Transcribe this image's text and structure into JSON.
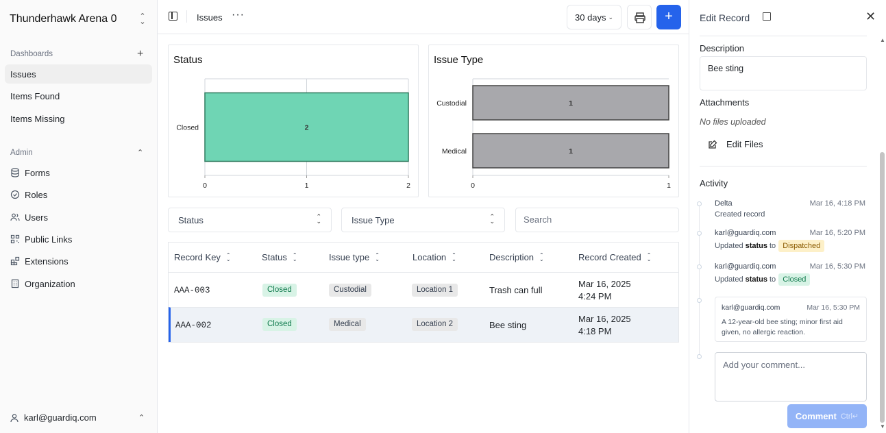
{
  "sidebar": {
    "org_name": "Thunderhawk Arena 0",
    "dashboards_label": "Dashboards",
    "dashboard_items": [
      {
        "label": "Issues",
        "active": true
      },
      {
        "label": "Items Found"
      },
      {
        "label": "Items Missing"
      }
    ],
    "admin_label": "Admin",
    "admin_items": [
      {
        "label": "Forms",
        "icon": "database-icon"
      },
      {
        "label": "Roles",
        "icon": "check-circle-icon"
      },
      {
        "label": "Users",
        "icon": "users-icon"
      },
      {
        "label": "Public Links",
        "icon": "qr-code-icon"
      },
      {
        "label": "Extensions",
        "icon": "blocks-icon"
      },
      {
        "label": "Organization",
        "icon": "building-icon"
      }
    ],
    "user_email": "karl@guardiq.com"
  },
  "topbar": {
    "title": "Issues",
    "range": "30 days"
  },
  "chart_data": [
    {
      "type": "bar",
      "title": "Status",
      "orientation": "horizontal",
      "categories": [
        "Closed"
      ],
      "values": [
        2
      ],
      "xlim": [
        0,
        2
      ],
      "x_ticks": [
        "0",
        "1",
        "2"
      ],
      "data_labels": [
        "2"
      ],
      "color": "#6fd5b4",
      "grid": true
    },
    {
      "type": "bar",
      "title": "Issue Type",
      "orientation": "horizontal",
      "categories": [
        "Custodial",
        "Medical"
      ],
      "values": [
        1,
        1
      ],
      "xlim": [
        0,
        1
      ],
      "x_ticks": [
        "0",
        "1"
      ],
      "data_labels": [
        "1",
        "1"
      ],
      "color": "#a8a8ac",
      "grid": false
    }
  ],
  "filters": {
    "status": "Status",
    "issue_type": "Issue Type",
    "search_placeholder": "Search"
  },
  "table": {
    "headers": [
      "Record Key",
      "Status",
      "Issue type",
      "Location",
      "Description",
      "Record Created"
    ],
    "rows": [
      {
        "key": "AAA-003",
        "status": "Closed",
        "type": "Custodial",
        "location": "Location 1",
        "description": "Trash can full",
        "created_date": "Mar 16, 2025",
        "created_time": "4:24 PM"
      },
      {
        "key": "AAA-002",
        "status": "Closed",
        "type": "Medical",
        "location": "Location 2",
        "description": "Bee sting",
        "created_date": "Mar 16, 2025",
        "created_time": "4:18 PM",
        "selected": true
      }
    ]
  },
  "panel": {
    "title": "Edit Record",
    "description_label": "Description",
    "description_value": "Bee sting",
    "attachments_label": "Attachments",
    "no_files": "No files uploaded",
    "edit_files": "Edit Files",
    "activity_label": "Activity",
    "activity": [
      {
        "who": "Delta",
        "when": "Mar 16, 4:18 PM",
        "what": "Created record"
      },
      {
        "who": "karl@guardiq.com",
        "when": "Mar 16, 5:20 PM",
        "prefix": "Updated",
        "field": "status",
        "to": "to",
        "value": "Dispatched"
      },
      {
        "who": "karl@guardiq.com",
        "when": "Mar 16, 5:30 PM",
        "prefix": "Updated",
        "field": "status",
        "to": "to",
        "value": "Closed"
      }
    ],
    "comment": {
      "who": "karl@guardiq.com",
      "when": "Mar 16, 5:30 PM",
      "body": "A 12-year-old bee sting; minor first aid given, no allergic reaction."
    },
    "comment_placeholder": "Add your comment...",
    "comment_button": "Comment",
    "comment_shortcut": "Ctrl↵"
  }
}
